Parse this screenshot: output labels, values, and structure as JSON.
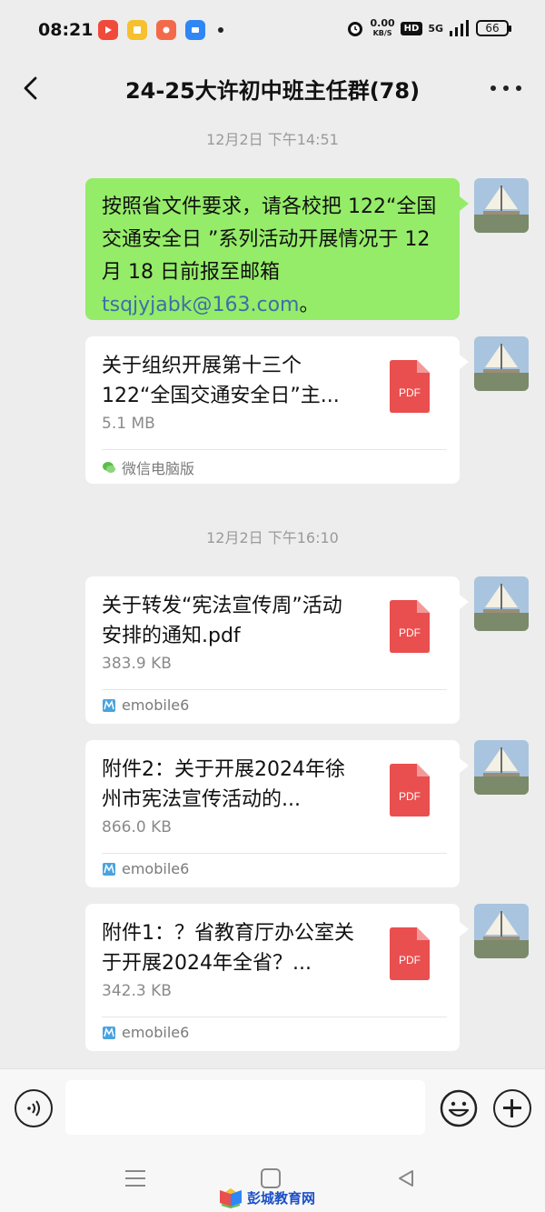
{
  "status_bar": {
    "time": "08:21",
    "net_speed_value": "0.00",
    "net_speed_unit": "KB/S",
    "hd_label": "HD",
    "signal_label": "5G",
    "battery": "66",
    "icons": [
      "alarm-icon",
      "app-icon-red",
      "app-icon-yellow",
      "app-icon-orange",
      "app-icon-blue"
    ]
  },
  "header": {
    "title": "24-25大许初中班主任群(78)"
  },
  "messages": {
    "timestamp_1": "12月2日 下午14:51",
    "text_bubble": {
      "text_before": "按照省文件要求，请各校把 122“全国交通安全日 ”系列活动开展情况于 12 月 18 日前报至邮箱 ",
      "email": "tsqjyjabk@163.com",
      "text_after": "。"
    },
    "file_1": {
      "title": "关于组织开展第十三个122“全国交通安全日”主...",
      "size": "5.1 MB",
      "type": "PDF",
      "source": "微信电脑版"
    },
    "timestamp_2": "12月2日 下午16:10",
    "file_2": {
      "title": "关于转发“宪法宣传周”活动安排的通知.pdf",
      "size": "383.9 KB",
      "type": "PDF",
      "source": "emobile6"
    },
    "file_3": {
      "title": "附件2：关于开展2024年徐州市宪法宣传活动的...",
      "size": "866.0 KB",
      "type": "PDF",
      "source": "emobile6"
    },
    "file_4": {
      "title": "附件1：？省教育厅办公室关于开展2024年全省？...",
      "size": "342.3 KB",
      "type": "PDF",
      "source": "emobile6"
    }
  },
  "input_bar": {
    "placeholder": ""
  },
  "watermark": {
    "text": "彭城教育网"
  },
  "colors": {
    "background": "#ededed",
    "sent_bubble": "#95ec69",
    "pdf_red": "#e94f4f",
    "link": "#3d6fa6"
  }
}
